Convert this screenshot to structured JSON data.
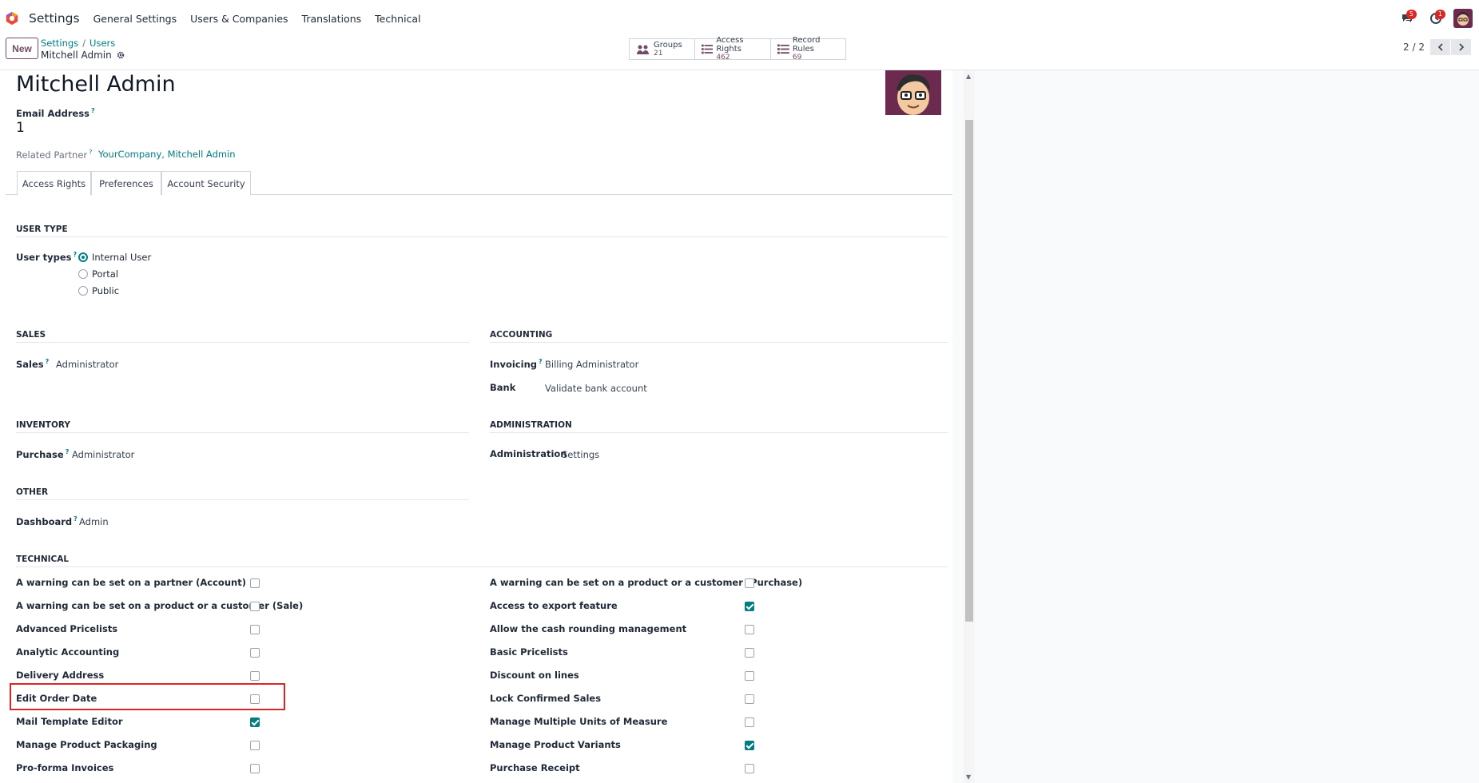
{
  "topbar": {
    "app_name": "Settings",
    "menu": [
      "General Settings",
      "Users & Companies",
      "Translations",
      "Technical"
    ],
    "messages_badge": "5",
    "activities_badge": "1"
  },
  "control": {
    "new_label": "New",
    "breadcrumb": [
      "Settings",
      "Users"
    ],
    "record_name": "Mitchell Admin",
    "smart_buttons": [
      {
        "label": "Groups",
        "count": "21",
        "icon": "users-icon"
      },
      {
        "label": "Access Rights",
        "count": "462",
        "icon": "list-icon"
      },
      {
        "label": "Record Rules",
        "count": "69",
        "icon": "list-icon"
      }
    ],
    "pager": "2 / 2"
  },
  "form": {
    "title": "Mitchell Admin",
    "email_label": "Email Address",
    "email_value": "1",
    "partner_label": "Related Partner",
    "partner_value": "YourCompany, Mitchell Admin",
    "tabs": [
      "Access Rights",
      "Preferences",
      "Account Security"
    ],
    "user_type_section": "USER TYPE",
    "user_types_label": "User types",
    "user_types": [
      {
        "label": "Internal User",
        "checked": true
      },
      {
        "label": "Portal",
        "checked": false
      },
      {
        "label": "Public",
        "checked": false
      }
    ],
    "sales": {
      "section": "SALES",
      "label": "Sales",
      "value": "Administrator"
    },
    "accounting": {
      "section": "ACCOUNTING",
      "invoicing_label": "Invoicing",
      "invoicing_value": "Billing Administrator",
      "bank_label": "Bank",
      "bank_value": "Validate bank account"
    },
    "inventory": {
      "section": "INVENTORY",
      "label": "Purchase",
      "value": "Administrator"
    },
    "administration": {
      "section": "ADMINISTRATION",
      "label": "Administration",
      "value": "Settings"
    },
    "other": {
      "section": "OTHER",
      "label": "Dashboard",
      "value": "Admin"
    },
    "technical_section": "TECHNICAL",
    "technical_left": [
      {
        "label": "A warning can be set on a partner (Account)",
        "checked": false
      },
      {
        "label": "A warning can be set on a product or a customer (Sale)",
        "checked": false
      },
      {
        "label": "Advanced Pricelists",
        "checked": false
      },
      {
        "label": "Analytic Accounting",
        "checked": false
      },
      {
        "label": "Delivery Address",
        "checked": false
      },
      {
        "label": "Edit Order Date",
        "checked": false
      },
      {
        "label": "Mail Template Editor",
        "checked": true
      },
      {
        "label": "Manage Product Packaging",
        "checked": false
      },
      {
        "label": "Pro-forma Invoices",
        "checked": false
      }
    ],
    "technical_right": [
      {
        "label": "A warning can be set on a product or a customer (Purchase)",
        "checked": false
      },
      {
        "label": "Access to export feature",
        "checked": true
      },
      {
        "label": "Allow the cash rounding management",
        "checked": false
      },
      {
        "label": "Basic Pricelists",
        "checked": false
      },
      {
        "label": "Discount on lines",
        "checked": false
      },
      {
        "label": "Lock Confirmed Sales",
        "checked": false
      },
      {
        "label": "Manage Multiple Units of Measure",
        "checked": false
      },
      {
        "label": "Manage Product Variants",
        "checked": true
      },
      {
        "label": "Purchase Receipt",
        "checked": false
      }
    ]
  },
  "colors": {
    "brand": "#714B67",
    "accent": "#017e84",
    "highlight": "#dc2626"
  }
}
